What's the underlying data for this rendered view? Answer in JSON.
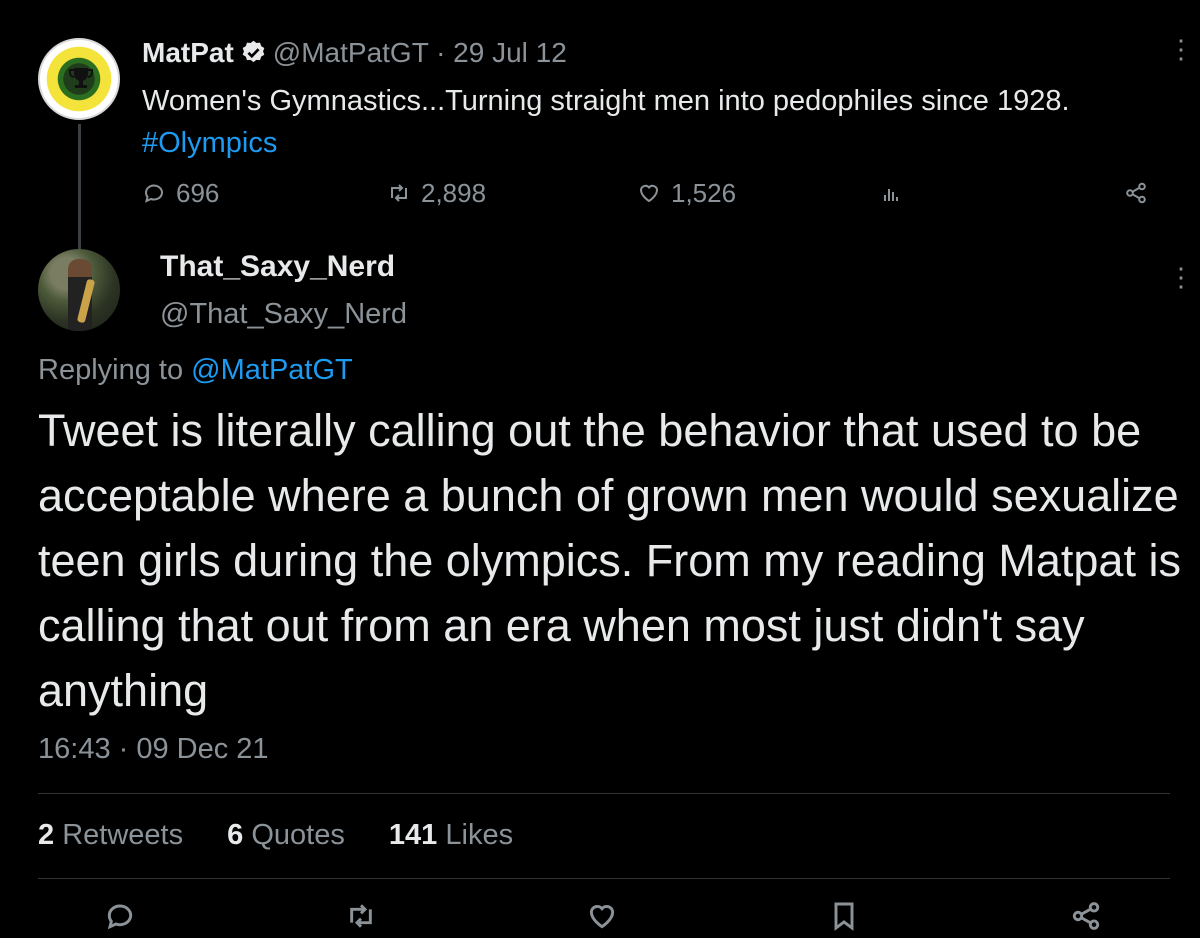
{
  "parent_tweet": {
    "author_name": "MatPat",
    "handle_time": "@MatPatGT · 29 Jul 12",
    "text_main": "Women's Gymnastics...Turning straight men into pedophiles since 1928. ",
    "hashtag": "#Olympics",
    "replies": "696",
    "retweets": "2,898",
    "likes": "1,526"
  },
  "reply_tweet": {
    "author_name": "That_Saxy_Nerd",
    "handle": "@That_Saxy_Nerd",
    "replying_prefix": "Replying to ",
    "replying_handle": "@MatPatGT",
    "text": "Tweet is literally calling out the behavior that used to be acceptable where a bunch of grown men would sexualize teen girls during the olympics. From my reading Matpat is calling that out from an era when most just didn't say anything",
    "timestamp": "16:43 · 09 Dec 21",
    "stats": {
      "retweets_count": "2",
      "retweets_label": "Retweets",
      "quotes_count": "6",
      "quotes_label": "Quotes",
      "likes_count": "141",
      "likes_label": "Likes"
    }
  },
  "icons": {
    "reply": "reply-icon",
    "retweet": "retweet-icon",
    "like": "heart-icon",
    "analytics": "analytics-icon",
    "share": "share-icon",
    "bookmark": "bookmark-icon",
    "more": "more-vertical-icon",
    "verified": "verified-badge-icon"
  },
  "colors": {
    "background": "#000000",
    "text": "#e7e9ea",
    "muted": "#8b9298",
    "link": "#1d9bf0"
  }
}
